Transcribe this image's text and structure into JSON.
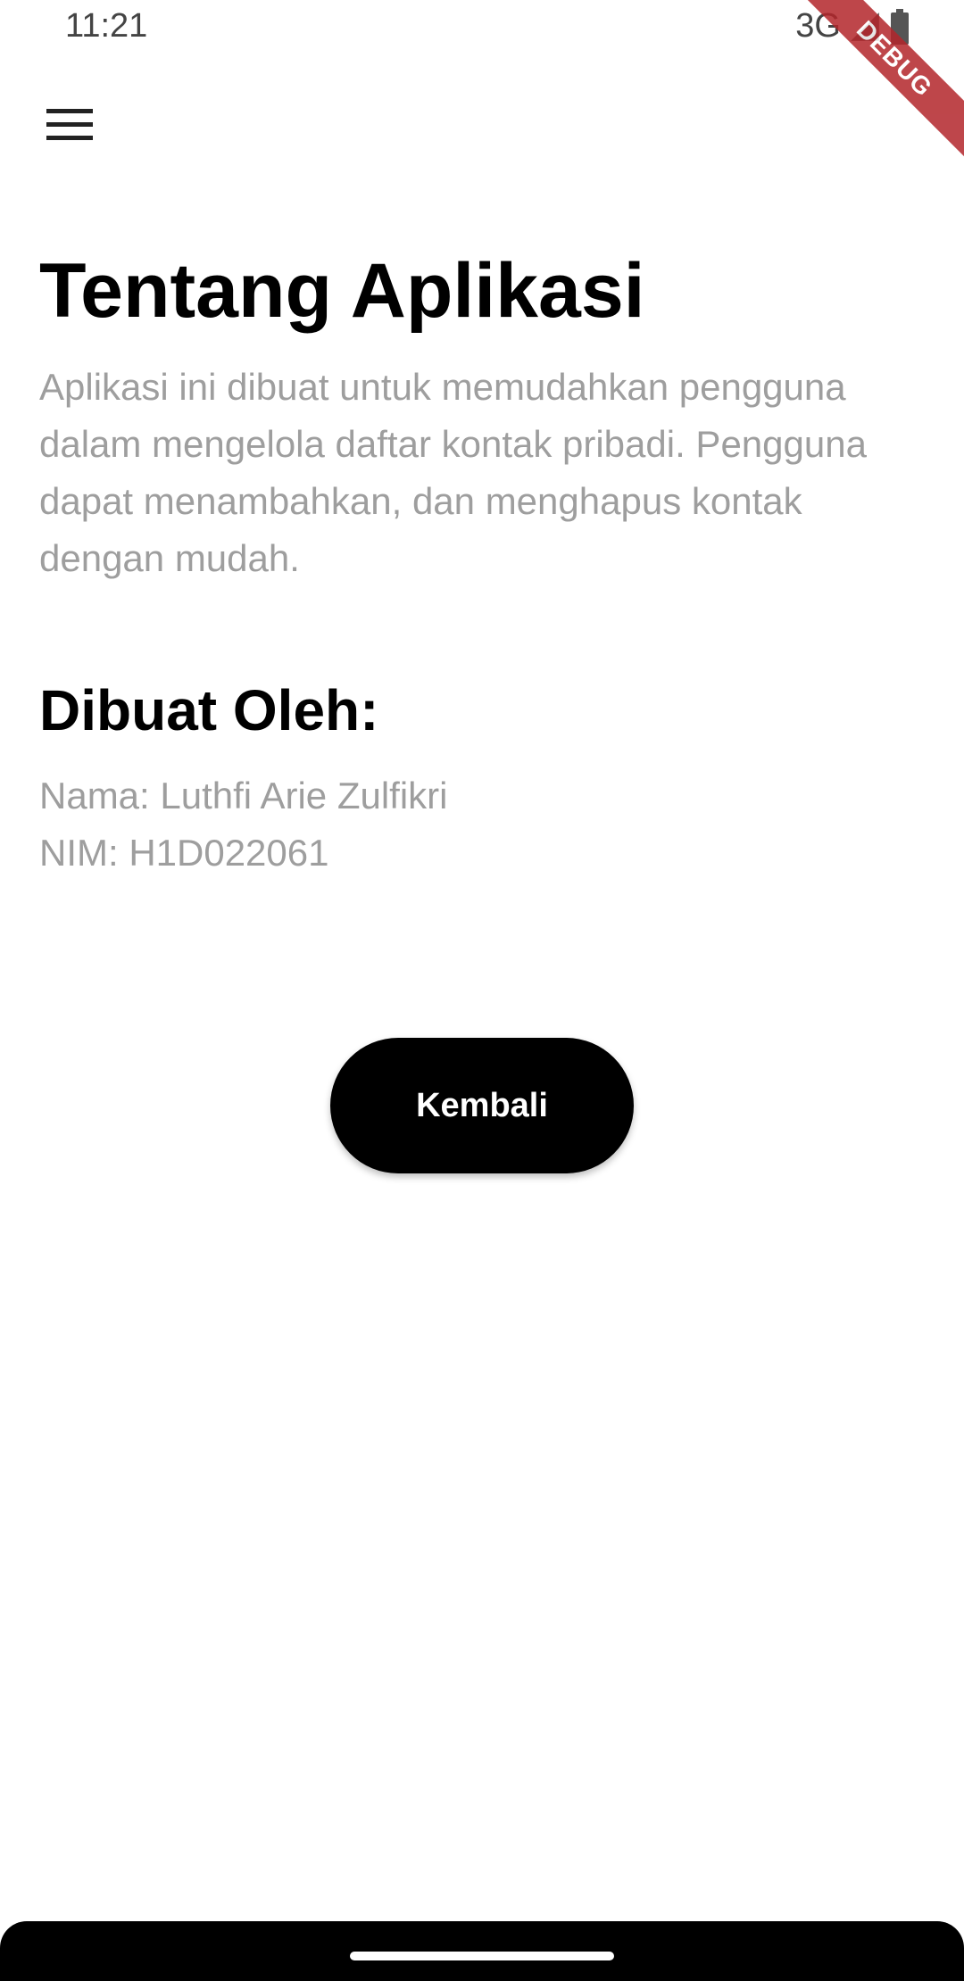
{
  "status_bar": {
    "time": "11:21",
    "network": "3G",
    "signal_icon": "signal-icon",
    "battery_icon": "battery-icon"
  },
  "debug_banner": {
    "label": "DEBUG",
    "color": "#b3262b"
  },
  "app_bar": {
    "menu_icon": "menu-icon"
  },
  "about": {
    "title": "Tentang Aplikasi",
    "description": "Aplikasi ini dibuat untuk memudahkan pengguna dalam mengelola daftar kontak pribadi. Pengguna dapat menambahkan, dan menghapus kontak dengan mudah."
  },
  "author": {
    "heading": "Dibuat Oleh:",
    "name_line": "Nama: Luthfi Arie Zulfikri",
    "nim_line": "NIM: H1D022061"
  },
  "actions": {
    "back_label": "Kembali"
  },
  "colors": {
    "primary_text": "#000000",
    "secondary_text": "#9e9e9e",
    "button_background": "#000000",
    "button_text": "#ffffff"
  }
}
